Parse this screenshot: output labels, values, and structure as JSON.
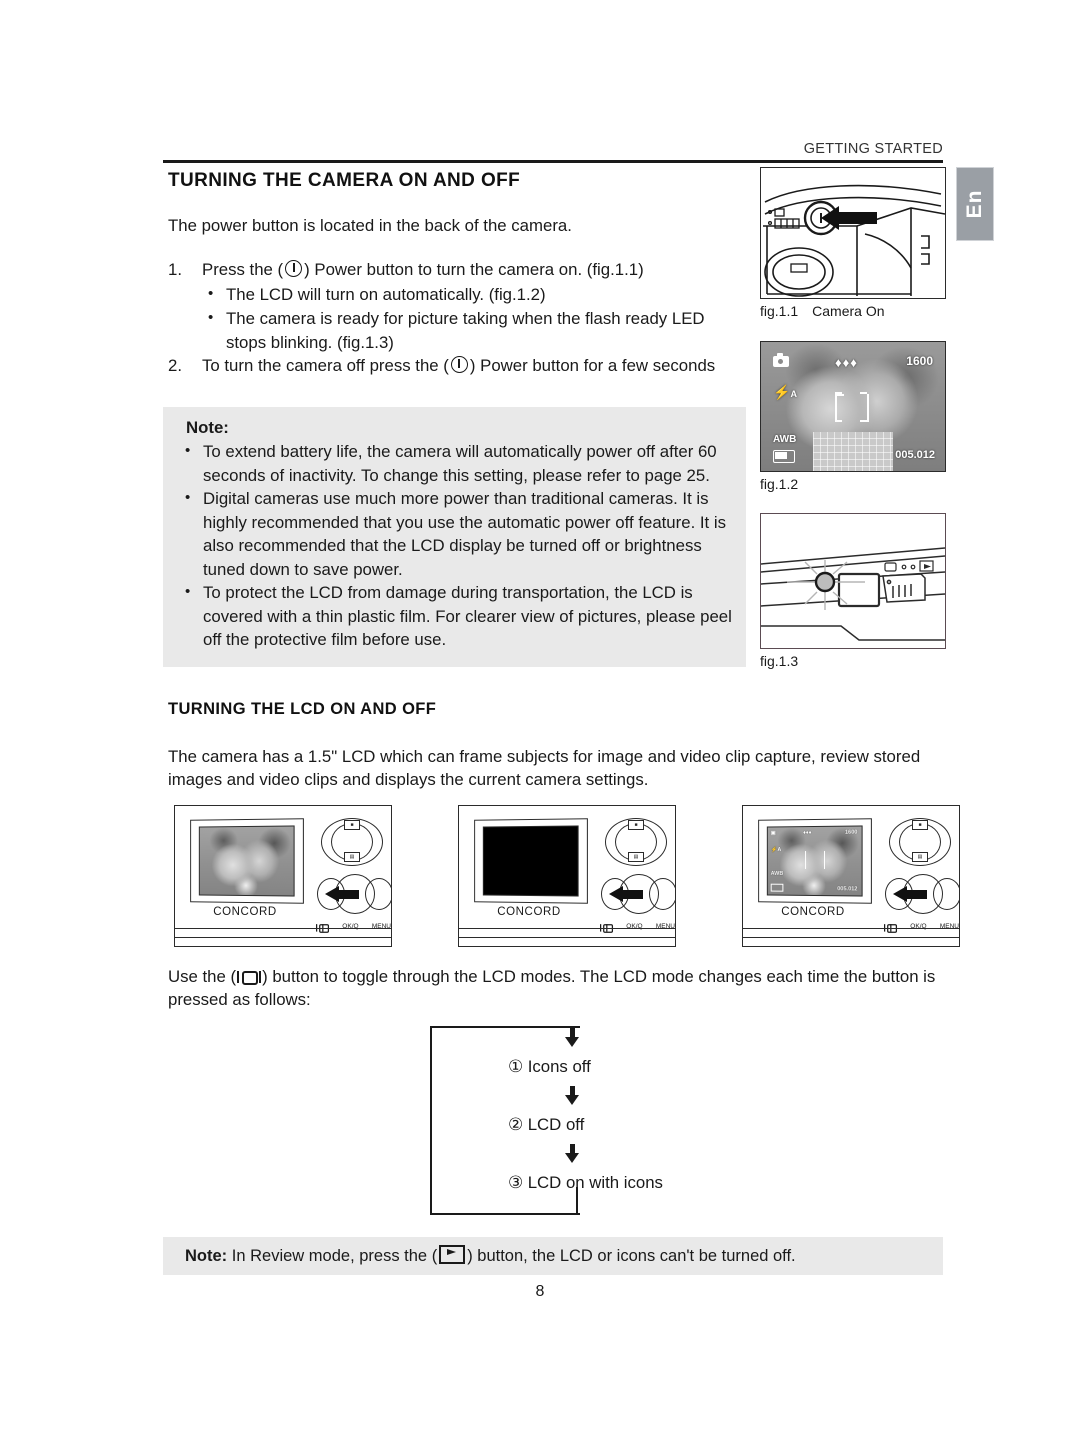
{
  "header": {
    "running_head": "GETTING STARTED",
    "language_tab": "En"
  },
  "sections": {
    "camera_onoff": {
      "heading": "TURNING THE CAMERA ON AND OFF",
      "intro": "The power button is located in the back of the camera.",
      "steps": [
        {
          "number": "1.",
          "text_before_icon": "Press the (",
          "icon": "power-icon",
          "text_after_icon": ") Power button to turn the camera on. (fig.1.1)",
          "subitems": [
            "The LCD will turn on automatically. (fig.1.2)",
            "The camera is ready for picture taking when the flash ready LED stops blinking. (fig.1.3)"
          ]
        },
        {
          "number": "2.",
          "text_before_icon": "To turn the camera off press the (",
          "icon": "power-icon",
          "text_after_icon": ") Power button for a few seconds",
          "subitems": []
        }
      ]
    },
    "note_box": {
      "title": "Note:",
      "bullets": [
        "To extend battery life, the camera will automatically power off after 60 seconds of inactivity. To change this setting, please refer to page 25.",
        "Digital cameras use much more power than traditional cameras. It is highly recommended that you use the automatic power off feature. It is also recommended that  the LCD display be turned off  or brightness tuned down to save power.",
        "To protect the LCD from damage during transportation, the LCD is covered with a thin plastic film. For clearer view of pictures, please peel off the protective film before use."
      ]
    },
    "lcd_onoff": {
      "heading": "TURNING THE LCD ON AND OFF",
      "description": "The camera has a 1.5\" LCD which can frame subjects for image and video clip capture, review stored images and video clips and displays the current camera settings.",
      "toggle_text_before_icon": "Use the (",
      "toggle_icon": "lcd-toggle-icon",
      "toggle_text_after_icon": ") button to toggle through the LCD modes. The LCD mode changes each time the button is pressed as follows:"
    },
    "bottom_note": {
      "label": "Note:",
      "text_before_icon": "In Review mode, press the (",
      "icon": "play-review-icon",
      "text_after_icon": ") button, the LCD or icons can't be turned off."
    }
  },
  "figures": [
    {
      "id": "fig11",
      "caption": "fig.1.1",
      "caption_extra": "Camera On",
      "alt": "camera-top-power-button-with-arrow"
    },
    {
      "id": "fig12",
      "caption": "fig.1.2",
      "caption_extra": "",
      "alt": "lcd-live-view-with-icons",
      "lcd_overlay": {
        "mode_icon": "camera-mode-icon",
        "quality": "♦♦♦",
        "resolution": "1600",
        "flash": "flash-auto-icon",
        "flash_label": "A",
        "white_balance": "AWB",
        "battery_icon": "battery-icon",
        "counter": "005.012"
      }
    },
    {
      "id": "fig13",
      "caption": "fig.1.3",
      "caption_extra": "",
      "alt": "camera-back-flash-ready-led-blinking"
    }
  ],
  "camera_backs": [
    {
      "id": "cb1",
      "mode": "icons-off",
      "brand": "CONCORD",
      "screen_state": "photo-no-icons",
      "button_labels": [
        "lcd-toggle-icon",
        "OK/Q",
        "MENU"
      ]
    },
    {
      "id": "cb2",
      "mode": "lcd-off",
      "brand": "CONCORD",
      "screen_state": "black",
      "button_labels": [
        "lcd-toggle-icon",
        "OK/Q",
        "MENU"
      ]
    },
    {
      "id": "cb3",
      "mode": "lcd-on-with-icons",
      "brand": "CONCORD",
      "screen_state": "photo-with-icons",
      "button_labels": [
        "lcd-toggle-icon",
        "OK/Q",
        "MENU"
      ],
      "overlay": {
        "mode_icon": "camera-mode-icon",
        "quality": "♦♦♦",
        "resolution": "1600",
        "flash_label": "A",
        "white_balance": "AWB",
        "counter": "005.012"
      }
    }
  ],
  "flow_diagram": {
    "steps": [
      "① Icons off",
      "② LCD off",
      "③ LCD on with icons"
    ]
  },
  "page_number": "8",
  "colors": {
    "note_background": "#e9e9e9",
    "tab_background": "#9a9fa5",
    "ink": "#1a1a1a"
  }
}
